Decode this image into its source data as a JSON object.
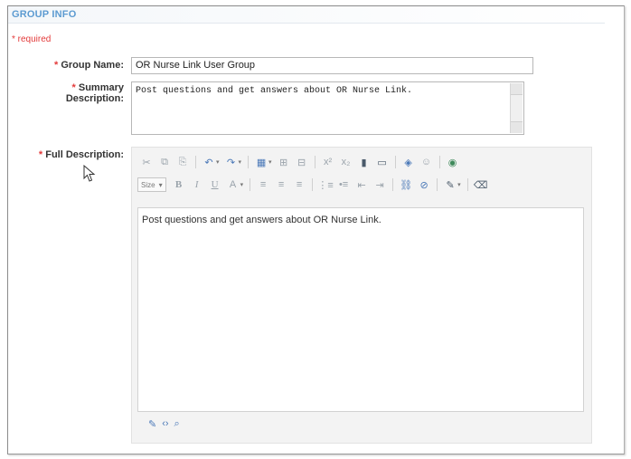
{
  "section": {
    "title": "GROUP INFO"
  },
  "required_note": "* required",
  "fields": {
    "group_name": {
      "label": "Group Name:",
      "value": "OR Nurse Link User Group"
    },
    "summary": {
      "label_line1": "Summary",
      "label_line2": "Description:",
      "value": "Post questions and get answers about OR Nurse Link."
    },
    "full_description": {
      "label": "Full Description:",
      "value": "Post questions and get answers about OR Nurse Link."
    }
  },
  "toolbar": {
    "row1_icons": [
      "cut-icon",
      "copy-icon",
      "paste-icon",
      "undo-icon",
      "redo-icon",
      "table-icon",
      "insert-row-icon",
      "insert-col-icon",
      "superscript-icon",
      "subscript-icon",
      "insert-image-icon",
      "insert-media-icon",
      "spellcheck-icon",
      "emoticon-icon",
      "link-icon"
    ],
    "row2_icons": [
      "bold-icon",
      "italic-icon",
      "underline-icon",
      "font-color-icon",
      "align-left-icon",
      "align-center-icon",
      "align-right-icon",
      "ordered-list-icon",
      "unordered-list-icon",
      "outdent-icon",
      "indent-icon",
      "insert-link-icon",
      "unlink-icon",
      "highlighter-icon",
      "clean-format-icon"
    ],
    "size_label": "Size",
    "glyphs": {
      "cut": "✂",
      "copy": "⧉",
      "paste": "⎘",
      "undo": "↶",
      "redo": "↷",
      "table": "▦",
      "row": "⊞",
      "col": "⊟",
      "sup": "x²",
      "sub": "x₂",
      "image": "▮",
      "media": "▭",
      "spell": "◈",
      "emoticon": "☺",
      "link_globe": "◉",
      "bold": "B",
      "italic": "I",
      "underline": "U",
      "font_color": "A",
      "align": "≡",
      "ol": "⋮≡",
      "ul": "•≡",
      "outdent": "⇤",
      "indent": "⇥",
      "link": "⛓",
      "unlink": "⊘",
      "brush": "✎",
      "clean": "⌫",
      "caret": "▾"
    },
    "mode_glyphs": {
      "design": "✎",
      "html": "‹›",
      "preview": "⌕"
    }
  },
  "colors": {
    "header_text": "#5c9bd1",
    "required": "#e33a3a"
  }
}
